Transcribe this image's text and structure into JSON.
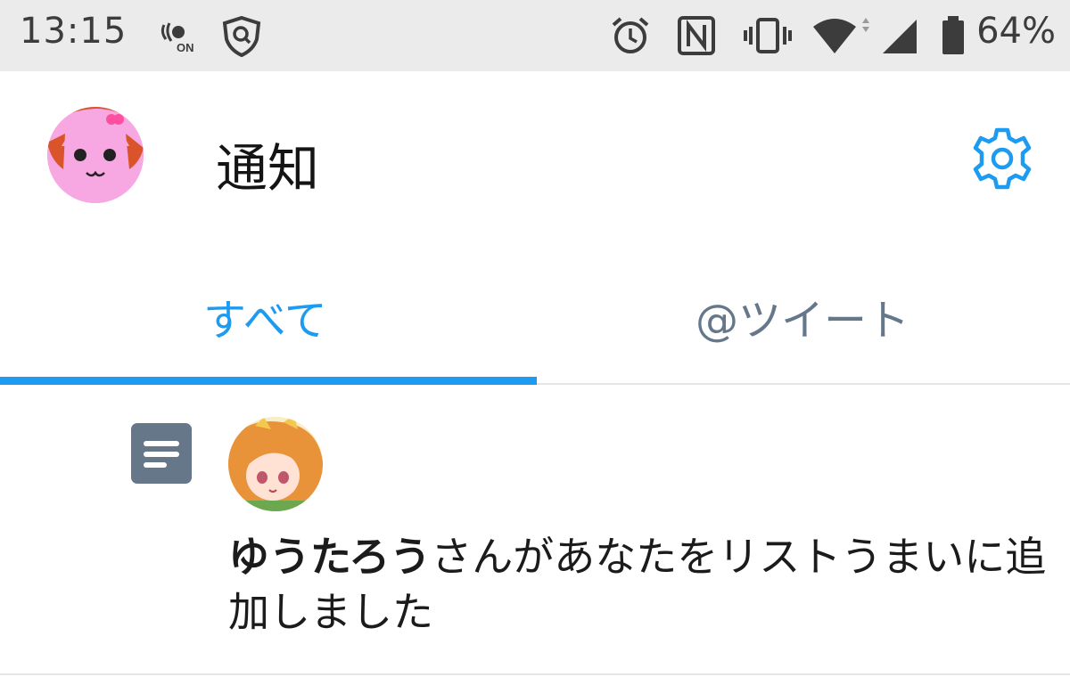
{
  "status_bar": {
    "time": "13:15",
    "battery_percent": "64%",
    "icons": [
      "nfc-on-icon",
      "vpn-shield-icon",
      "alarm-icon",
      "nfc-icon",
      "vibrate-icon",
      "wifi-icon",
      "signal-icon",
      "battery-icon"
    ]
  },
  "header": {
    "title": "通知",
    "settings_icon": "gear-icon",
    "accent_color": "#1d9bf0"
  },
  "tabs": [
    {
      "label": "すべて",
      "active": true
    },
    {
      "label": "@ツイート",
      "active": false
    }
  ],
  "notifications": [
    {
      "type_icon": "list-icon",
      "user_name": "ゆうたろう",
      "message": "さんがあなたをリストうまいに追加しました"
    }
  ]
}
